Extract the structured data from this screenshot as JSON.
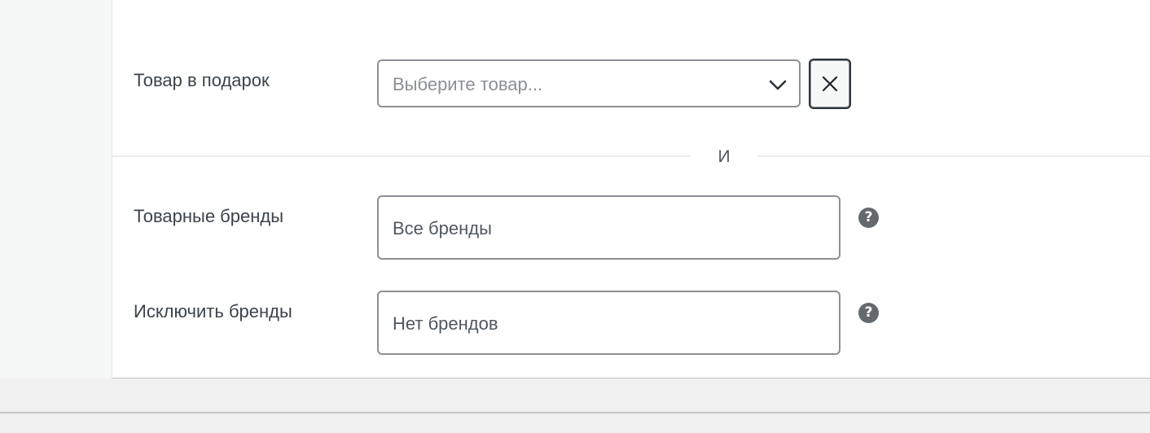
{
  "gift_product": {
    "label": "Товар в подарок",
    "placeholder": "Выберите товар..."
  },
  "divider": {
    "text": "И"
  },
  "product_brands": {
    "label": "Товарные бренды",
    "placeholder": "Все бренды"
  },
  "exclude_brands": {
    "label": "Исключить бренды",
    "placeholder": "Нет брендов"
  },
  "icons": {
    "dropdown": "chevron-down-icon",
    "clear": "close-icon",
    "help": "help-icon",
    "help_glyph": "?"
  },
  "colors": {
    "border": "#8c8f94",
    "text": "#3c434a",
    "help_bg": "#646970"
  }
}
